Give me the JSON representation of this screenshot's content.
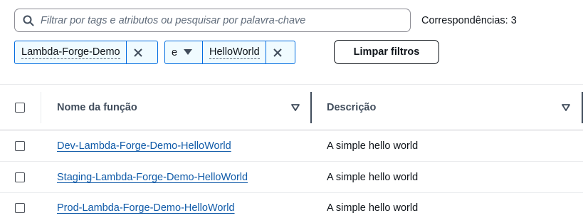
{
  "search": {
    "placeholder": "Filtrar por tags e atributos ou pesquisar por palavra-chave",
    "value": "",
    "matches_label": "Correspondências: 3"
  },
  "filters": {
    "tokens": [
      {
        "label": "Lambda-Forge-Demo"
      },
      {
        "label": "HelloWorld"
      }
    ],
    "operator": "e",
    "clear_label": "Limpar filtros"
  },
  "table": {
    "columns": [
      {
        "label": "Nome da função"
      },
      {
        "label": "Descrição"
      }
    ],
    "rows": [
      {
        "name": "Dev-Lambda-Forge-Demo-HelloWorld",
        "description": "A simple hello world"
      },
      {
        "name": "Staging-Lambda-Forge-Demo-HelloWorld",
        "description": "A simple hello world"
      },
      {
        "name": "Prod-Lambda-Forge-Demo-HelloWorld",
        "description": "A simple hello world"
      }
    ]
  },
  "colors": {
    "accent": "#006ce0",
    "link": "#0f5aa8",
    "token_bg": "#f0fbff"
  }
}
